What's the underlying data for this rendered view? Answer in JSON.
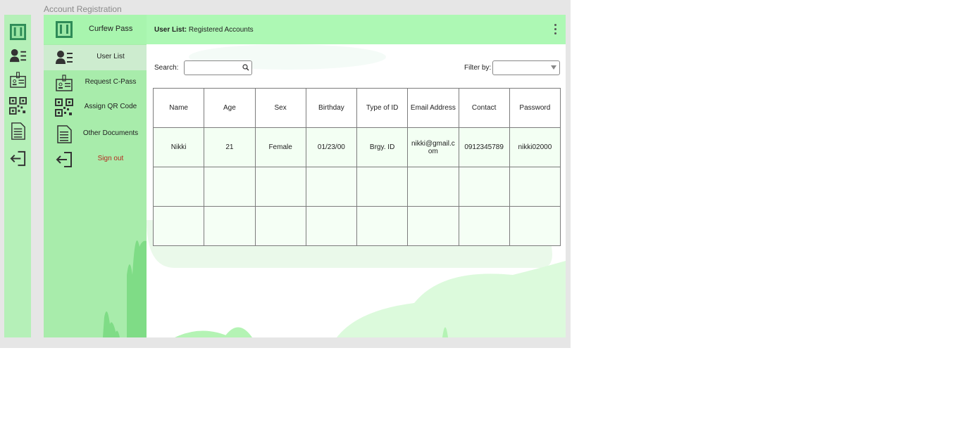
{
  "frame": {
    "title": "Account Registration"
  },
  "app": {
    "brand": "Curfew Pass"
  },
  "colors": {
    "accent": "#a8f5ae",
    "sidebar": "#a8ecab",
    "signout": "#b52a1e"
  },
  "rail": {
    "icons": [
      "logo-icon",
      "user-list-icon",
      "id-card-icon",
      "qr-code-icon",
      "document-icon",
      "sign-out-icon"
    ]
  },
  "nav": {
    "items": [
      {
        "label": "User List",
        "icon": "user-list-icon",
        "active": true
      },
      {
        "label": "Request C-Pass",
        "icon": "id-card-icon"
      },
      {
        "label": "Assign QR Code",
        "icon": "qr-code-icon"
      },
      {
        "label": "Other Documents",
        "icon": "document-icon"
      },
      {
        "label": "Sign out",
        "icon": "sign-out-icon"
      }
    ]
  },
  "header": {
    "title_bold": "User List:",
    "title_rest": "Registered Accounts"
  },
  "search": {
    "label": "Search:",
    "value": "",
    "placeholder": ""
  },
  "filter": {
    "label": "Filter by:",
    "value": ""
  },
  "table": {
    "columns": [
      "Name",
      "Age",
      "Sex",
      "Birthday",
      "Type of ID",
      "Email Address",
      "Contact",
      "Password"
    ],
    "rows": [
      [
        "Nikki",
        "21",
        "Female",
        "01/23/00",
        "Brgy. ID",
        "nikki@gmail.com",
        "0912345789",
        "nikki02000"
      ],
      [
        "",
        "",
        "",
        "",
        "",
        "",
        "",
        ""
      ],
      [
        "",
        "",
        "",
        "",
        "",
        "",
        "",
        ""
      ]
    ]
  }
}
